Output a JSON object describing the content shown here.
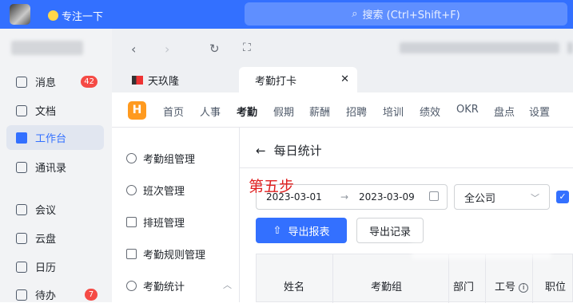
{
  "topbar": {
    "focus_label": "专注一下",
    "search_placeholder": "搜索 (Ctrl+Shift+F)"
  },
  "sidebar": {
    "items": [
      {
        "label": "消息",
        "badge": "42"
      },
      {
        "label": "文档"
      },
      {
        "label": "工作台"
      },
      {
        "label": "通讯录"
      },
      {
        "label": "会议"
      },
      {
        "label": "云盘"
      },
      {
        "label": "日历"
      },
      {
        "label": "待办",
        "badge": "7"
      }
    ]
  },
  "tabs": [
    {
      "label": "天玖隆"
    },
    {
      "label": "考勤打卡"
    }
  ],
  "appnav": {
    "items": [
      "首页",
      "人事",
      "考勤",
      "假期",
      "薪酬",
      "招聘",
      "培训",
      "绩效",
      "OKR",
      "盘点",
      "设置"
    ]
  },
  "submenu": {
    "items": [
      "考勤组管理",
      "班次管理",
      "排班管理",
      "考勤规则管理",
      "考勤统计"
    ]
  },
  "main": {
    "title": "每日统计",
    "annotation": "第五步",
    "start_date": "2023-03-01",
    "end_date": "2023-03-09",
    "company": "全公司",
    "export_report": "导出报表",
    "export_records": "导出记录",
    "columns": [
      "姓名",
      "考勤组",
      "部门",
      "工号",
      "职位"
    ]
  },
  "colors": {
    "accent": "#3370ff",
    "annotation": "#e02020",
    "badge": "#f54a45"
  }
}
